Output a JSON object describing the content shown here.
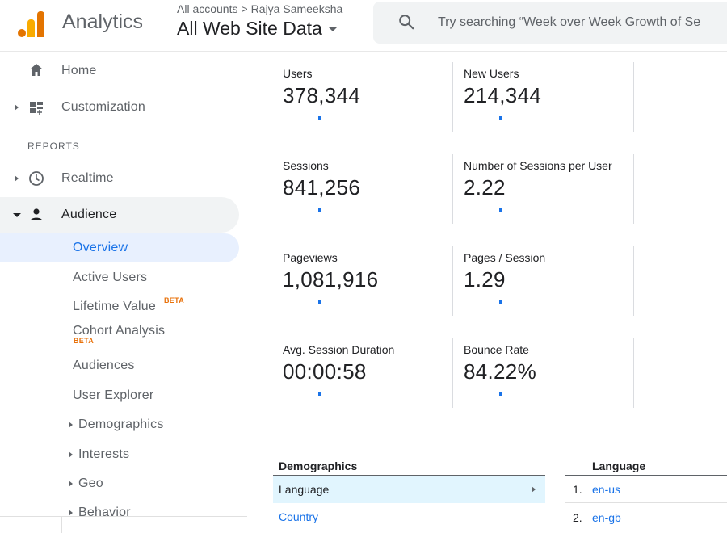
{
  "header": {
    "app_name": "Analytics",
    "breadcrumb": [
      "All accounts",
      "Rajya Sameeksha"
    ],
    "breadcrumb_separator": ">",
    "property": "All Web Site Data",
    "search_placeholder": "Try searching “Week over Week Growth of Se"
  },
  "sidebar": {
    "home": "Home",
    "customization": "Customization",
    "reports_label": "REPORTS",
    "realtime": "Realtime",
    "audience": "Audience",
    "sub_items": {
      "overview": "Overview",
      "active_users": "Active Users",
      "lifetime_value": "Lifetime Value",
      "cohort_analysis": "Cohort Analysis",
      "audiences": "Audiences",
      "user_explorer": "User Explorer",
      "demographics": "Demographics",
      "interests": "Interests",
      "geo": "Geo",
      "behavior": "Behavior"
    },
    "beta_label": "BETA"
  },
  "metrics": [
    {
      "name": "Users",
      "value": "378,344"
    },
    {
      "name": "New Users",
      "value": "214,344"
    },
    {
      "name": "Sessions",
      "value": "841,256"
    },
    {
      "name": "Number of Sessions per User",
      "value": "2.22"
    },
    {
      "name": "Pageviews",
      "value": "1,081,916"
    },
    {
      "name": "Pages / Session",
      "value": "1.29"
    },
    {
      "name": "Avg. Session Duration",
      "value": "00:00:58"
    },
    {
      "name": "Bounce Rate",
      "value": "84.22%"
    }
  ],
  "demographics": {
    "heading": "Demographics",
    "rows": [
      "Language",
      "Country"
    ]
  },
  "language": {
    "heading": "Language",
    "rows": [
      {
        "num": "1.",
        "label": "en-us"
      },
      {
        "num": "2.",
        "label": "en-gb"
      }
    ]
  },
  "colors": {
    "accent": "#1a73e8",
    "logo_orange": "#e37400",
    "logo_yellow": "#f9ab00",
    "beta": "#e8710a"
  }
}
